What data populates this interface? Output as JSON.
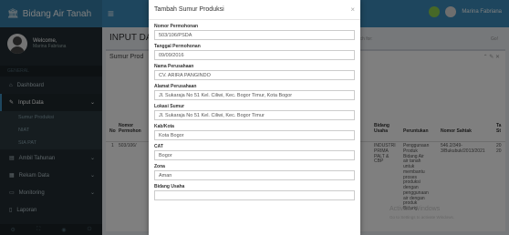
{
  "app": {
    "brand": "Bidang Air Tanah",
    "hamburger": "≡"
  },
  "user": {
    "greeting": "Welcome,",
    "name": "Marina Fabriana"
  },
  "sidebar": {
    "section": "GENERAL",
    "items": [
      {
        "label": "Dashboard",
        "icon": "⌂"
      },
      {
        "label": "Input Data",
        "icon": "✎",
        "chev": "⌄"
      },
      {
        "label": "Sumur Produksi",
        "sub": true
      },
      {
        "label": "NIAT",
        "sub": true
      },
      {
        "label": "SIA PAT",
        "sub": true
      },
      {
        "label": "Ambil Tahunan",
        "icon": "▤",
        "chev": "⌄"
      },
      {
        "label": "Rekam Data",
        "icon": "▦",
        "chev": "⌄"
      },
      {
        "label": "Monitoring",
        "icon": "▭",
        "chev": "⌄"
      },
      {
        "label": "Laporan",
        "icon": "▯"
      }
    ],
    "footer_icons": [
      "⚙",
      "⛶",
      "◉",
      "⏻"
    ]
  },
  "topbar": {
    "user": "Marina Fabriana"
  },
  "page": {
    "title": "INPUT DAT",
    "search_label": "Search for:",
    "search_go": "Go!"
  },
  "box": {
    "title": "Sumur Prod",
    "tools": "⌃ ✎ ✕"
  },
  "table": {
    "headers": [
      "No",
      "Nomor\nPermohon",
      "Bidang\nUsaha",
      "Peruntukan",
      "Nomor Sahtak",
      "Ta\nSt"
    ],
    "row": {
      "no": "1",
      "nomor": "503/106/",
      "bidang": "INDUSTRI\nPRIMA\nPALT &\nCBP",
      "peruntukan": "Penggunaan\nProduk\nBidang Air\nair tanah\nuntuk\nmembantu\nproses\nproduksi\ndengan\npenggunaan\nair dengan\nproduk\nBidang",
      "sahtak": "546.2/349-\n3/Bukubuk/2013/2021",
      "ta": "20\n20"
    }
  },
  "watermark": {
    "line1": "Activate Windows",
    "line2": "Go to Settings to activate Windows."
  },
  "modal": {
    "title": "Tambah Sumur Produksi",
    "close": "×",
    "fields": [
      {
        "label": "Nomor Permohonan",
        "value": "503/106/PSDA"
      },
      {
        "label": "Tanggal Permohonan",
        "value": "09/09/2016"
      },
      {
        "label": "Nama Perusahaan",
        "value": "CV. ARIRA PANGINDO"
      },
      {
        "label": "Alamat Perusahaan",
        "value": "Jl. Sukaraja No 51 Kel. Ciliwi, Kec. Bogor Timur, Kota Bogor"
      },
      {
        "label": "Lokasi Sumur",
        "value": "Jl. Sukaraja No 51 Kel. Ciliwi, Kec. Bogor Timur"
      },
      {
        "label": "Kab/Kota",
        "value": "Kota Bogor"
      },
      {
        "label": "CAT",
        "value": "Bogor"
      },
      {
        "label": "Zona",
        "value": "Aman"
      },
      {
        "label": "Bidang Usaha",
        "value": ""
      }
    ]
  }
}
